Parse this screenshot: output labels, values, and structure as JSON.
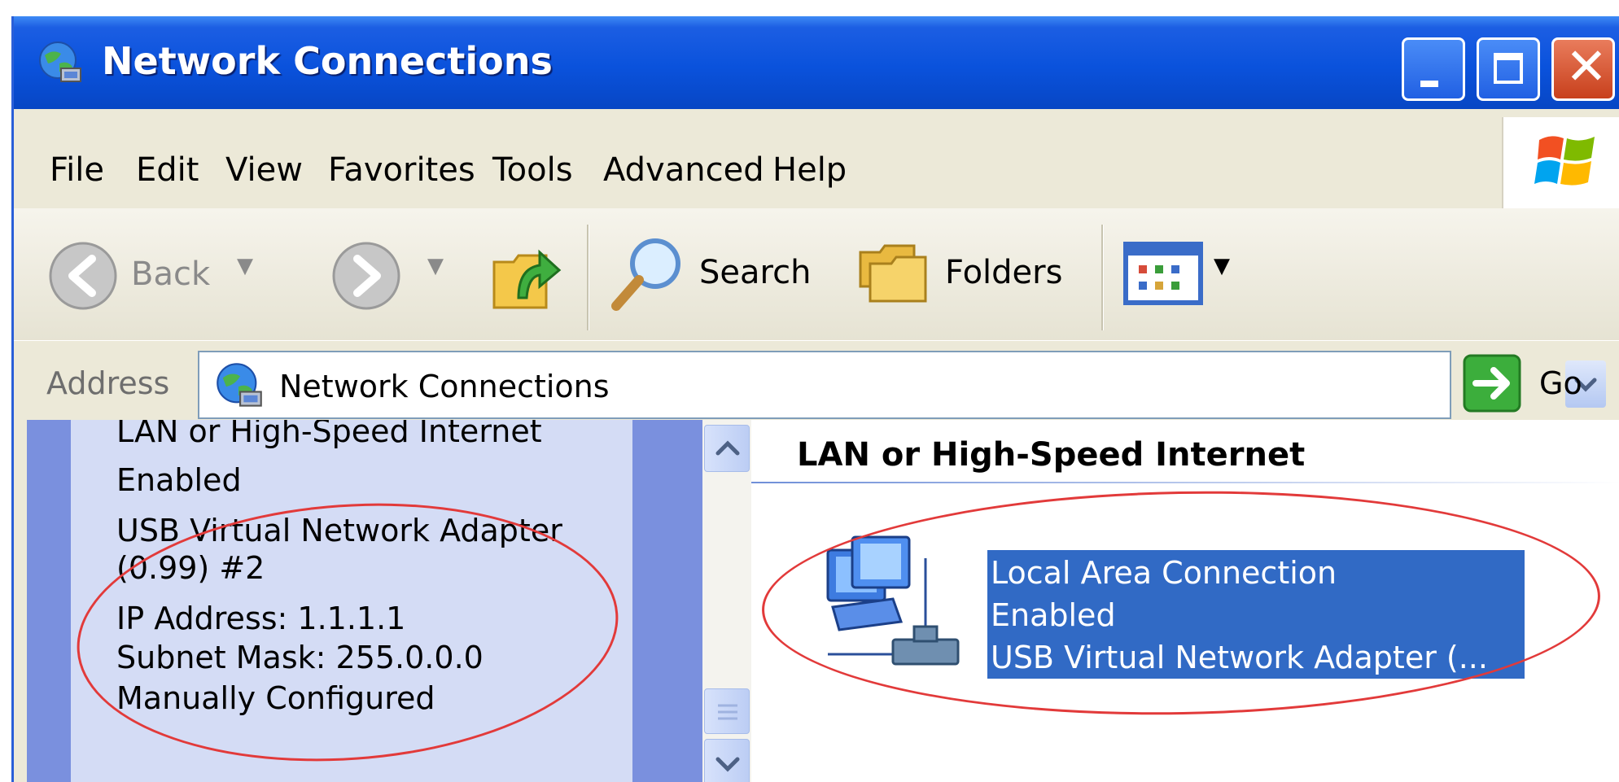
{
  "window": {
    "title": "Network Connections",
    "icon": "network-connections-icon"
  },
  "title_controls": [
    "minimize-icon",
    "maximize-icon",
    "close-icon"
  ],
  "menu": {
    "items": [
      "File",
      "Edit",
      "View",
      "Favorites",
      "Tools",
      "Advanced",
      "Help"
    ]
  },
  "toolbar": {
    "back_label": "Back",
    "search_label": "Search",
    "folders_label": "Folders",
    "icons": [
      "back-arrow-icon",
      "forward-arrow-icon",
      "up-folder-icon",
      "search-icon",
      "folders-icon",
      "views-icon"
    ]
  },
  "address": {
    "label": "Address",
    "value": "Network Connections",
    "go_label": "Go"
  },
  "details": {
    "lines": [
      "LAN or High-Speed Internet",
      "Enabled",
      "USB Virtual Network Adapter",
      "(0.99) #2",
      "IP Address: 1.1.1.1",
      "Subnet Mask: 255.0.0.0",
      "Manually Configured"
    ]
  },
  "content": {
    "group_header": "LAN or High-Speed Internet",
    "connection": {
      "name": "Local Area Connection",
      "status": "Enabled",
      "device": "USB Virtual Network Adapter (..."
    }
  },
  "colors": {
    "titlebar": "#0a52dc",
    "selection": "#316ac5",
    "annotation": "#e23a3a",
    "task_pane": "#d4dcf5"
  }
}
